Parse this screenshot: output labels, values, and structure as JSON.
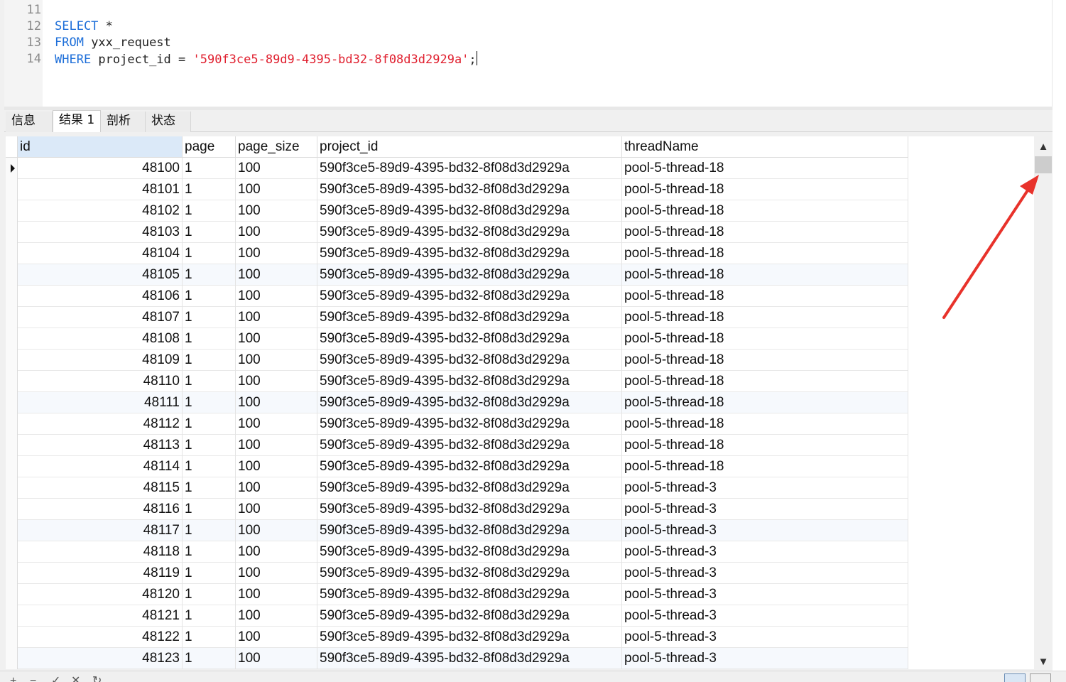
{
  "editor": {
    "line_numbers": [
      "11",
      "12",
      "13",
      "14"
    ],
    "lines": [
      {
        "tokens": []
      },
      {
        "tokens": [
          {
            "t": "SELECT",
            "k": "kw"
          },
          {
            "t": " *",
            "k": "plain"
          }
        ]
      },
      {
        "tokens": [
          {
            "t": "FROM",
            "k": "kw"
          },
          {
            "t": " yxx_request",
            "k": "plain"
          }
        ]
      },
      {
        "tokens": [
          {
            "t": "WHERE",
            "k": "kw"
          },
          {
            "t": " project_id = ",
            "k": "plain"
          },
          {
            "t": "'590f3ce5-89d9-4395-bd32-8f08d3d2929a'",
            "k": "str"
          },
          {
            "t": ";",
            "k": "plain"
          }
        ]
      }
    ]
  },
  "tabs": [
    {
      "label": "信息",
      "active": false
    },
    {
      "label": "结果 1",
      "active": true
    },
    {
      "label": "剖析",
      "active": false
    },
    {
      "label": "状态",
      "active": false
    }
  ],
  "grid": {
    "columns": [
      "id",
      "page",
      "page_size",
      "project_id",
      "threadName"
    ],
    "rows": [
      [
        "48100",
        "1",
        "100",
        "590f3ce5-89d9-4395-bd32-8f08d3d2929a",
        "pool-5-thread-18"
      ],
      [
        "48101",
        "1",
        "100",
        "590f3ce5-89d9-4395-bd32-8f08d3d2929a",
        "pool-5-thread-18"
      ],
      [
        "48102",
        "1",
        "100",
        "590f3ce5-89d9-4395-bd32-8f08d3d2929a",
        "pool-5-thread-18"
      ],
      [
        "48103",
        "1",
        "100",
        "590f3ce5-89d9-4395-bd32-8f08d3d2929a",
        "pool-5-thread-18"
      ],
      [
        "48104",
        "1",
        "100",
        "590f3ce5-89d9-4395-bd32-8f08d3d2929a",
        "pool-5-thread-18"
      ],
      [
        "48105",
        "1",
        "100",
        "590f3ce5-89d9-4395-bd32-8f08d3d2929a",
        "pool-5-thread-18"
      ],
      [
        "48106",
        "1",
        "100",
        "590f3ce5-89d9-4395-bd32-8f08d3d2929a",
        "pool-5-thread-18"
      ],
      [
        "48107",
        "1",
        "100",
        "590f3ce5-89d9-4395-bd32-8f08d3d2929a",
        "pool-5-thread-18"
      ],
      [
        "48108",
        "1",
        "100",
        "590f3ce5-89d9-4395-bd32-8f08d3d2929a",
        "pool-5-thread-18"
      ],
      [
        "48109",
        "1",
        "100",
        "590f3ce5-89d9-4395-bd32-8f08d3d2929a",
        "pool-5-thread-18"
      ],
      [
        "48110",
        "1",
        "100",
        "590f3ce5-89d9-4395-bd32-8f08d3d2929a",
        "pool-5-thread-18"
      ],
      [
        "48111",
        "1",
        "100",
        "590f3ce5-89d9-4395-bd32-8f08d3d2929a",
        "pool-5-thread-18"
      ],
      [
        "48112",
        "1",
        "100",
        "590f3ce5-89d9-4395-bd32-8f08d3d2929a",
        "pool-5-thread-18"
      ],
      [
        "48113",
        "1",
        "100",
        "590f3ce5-89d9-4395-bd32-8f08d3d2929a",
        "pool-5-thread-18"
      ],
      [
        "48114",
        "1",
        "100",
        "590f3ce5-89d9-4395-bd32-8f08d3d2929a",
        "pool-5-thread-18"
      ],
      [
        "48115",
        "1",
        "100",
        "590f3ce5-89d9-4395-bd32-8f08d3d2929a",
        "pool-5-thread-3"
      ],
      [
        "48116",
        "1",
        "100",
        "590f3ce5-89d9-4395-bd32-8f08d3d2929a",
        "pool-5-thread-3"
      ],
      [
        "48117",
        "1",
        "100",
        "590f3ce5-89d9-4395-bd32-8f08d3d2929a",
        "pool-5-thread-3"
      ],
      [
        "48118",
        "1",
        "100",
        "590f3ce5-89d9-4395-bd32-8f08d3d2929a",
        "pool-5-thread-3"
      ],
      [
        "48119",
        "1",
        "100",
        "590f3ce5-89d9-4395-bd32-8f08d3d2929a",
        "pool-5-thread-3"
      ],
      [
        "48120",
        "1",
        "100",
        "590f3ce5-89d9-4395-bd32-8f08d3d2929a",
        "pool-5-thread-3"
      ],
      [
        "48121",
        "1",
        "100",
        "590f3ce5-89d9-4395-bd32-8f08d3d2929a",
        "pool-5-thread-3"
      ],
      [
        "48122",
        "1",
        "100",
        "590f3ce5-89d9-4395-bd32-8f08d3d2929a",
        "pool-5-thread-3"
      ],
      [
        "48123",
        "1",
        "100",
        "590f3ce5-89d9-4395-bd32-8f08d3d2929a",
        "pool-5-thread-3"
      ]
    ],
    "highlighted_rows": [
      5,
      11,
      17,
      23
    ],
    "current_row": 0
  },
  "scrollbar": {
    "up_icon": "▲",
    "down_icon": "▼"
  },
  "toolbar": {
    "add_icon": "+",
    "remove_icon": "−",
    "apply_icon": "✓",
    "discard_icon": "✕",
    "refresh_icon": "↻"
  },
  "annotation": {
    "arrow_color": "#e8322b"
  }
}
